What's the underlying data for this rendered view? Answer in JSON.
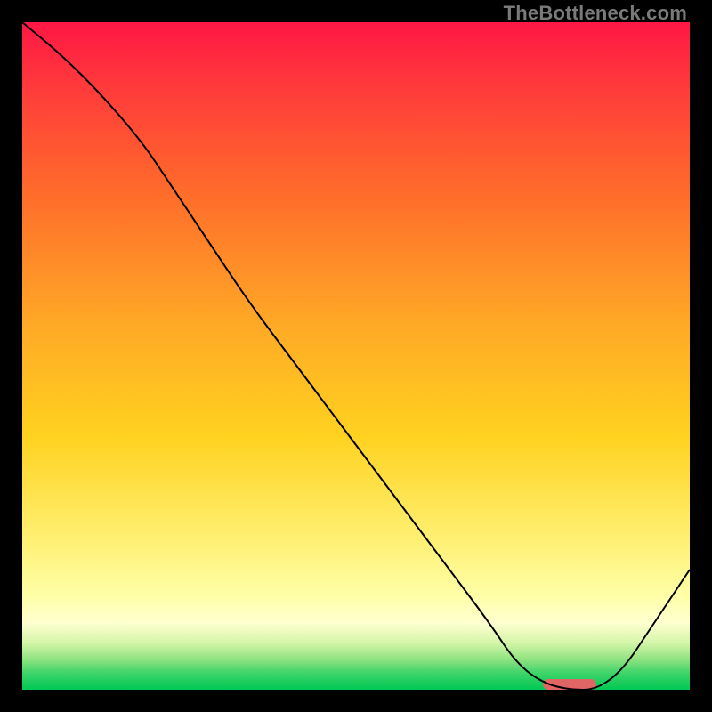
{
  "watermark": "TheBottleneck.com",
  "chart_data": {
    "type": "line",
    "title": "",
    "xlabel": "",
    "ylabel": "",
    "xlim": [
      0,
      100
    ],
    "ylim": [
      0,
      100
    ],
    "grid": false,
    "series": [
      {
        "name": "curve",
        "x": [
          0,
          6,
          12,
          18,
          22,
          28,
          34,
          40,
          46,
          52,
          58,
          64,
          70,
          74,
          78,
          82,
          86,
          90,
          94,
          100
        ],
        "y": [
          100,
          95,
          89,
          82,
          76,
          67,
          58,
          50,
          42,
          34,
          26,
          18,
          10,
          4,
          1,
          0,
          0,
          3,
          9,
          18
        ],
        "stroke": "#000000",
        "stroke_width": 2
      }
    ],
    "marker": {
      "name": "optimum-marker",
      "x_start": 78,
      "x_end": 86,
      "y": 0.8,
      "color": "#e06666",
      "thickness": 12
    },
    "background_gradient": {
      "stops": [
        {
          "offset": 0.0,
          "color": "#ff1744"
        },
        {
          "offset": 0.1,
          "color": "#ff3b3b"
        },
        {
          "offset": 0.25,
          "color": "#ff6a2b"
        },
        {
          "offset": 0.45,
          "color": "#ffa826"
        },
        {
          "offset": 0.62,
          "color": "#ffd21f"
        },
        {
          "offset": 0.78,
          "color": "#fff176"
        },
        {
          "offset": 0.86,
          "color": "#ffffa8"
        },
        {
          "offset": 0.9,
          "color": "#ffffd0"
        },
        {
          "offset": 0.93,
          "color": "#d4f5a8"
        },
        {
          "offset": 0.955,
          "color": "#8ee27f"
        },
        {
          "offset": 0.975,
          "color": "#3ed46a"
        },
        {
          "offset": 1.0,
          "color": "#00c853"
        }
      ]
    }
  }
}
